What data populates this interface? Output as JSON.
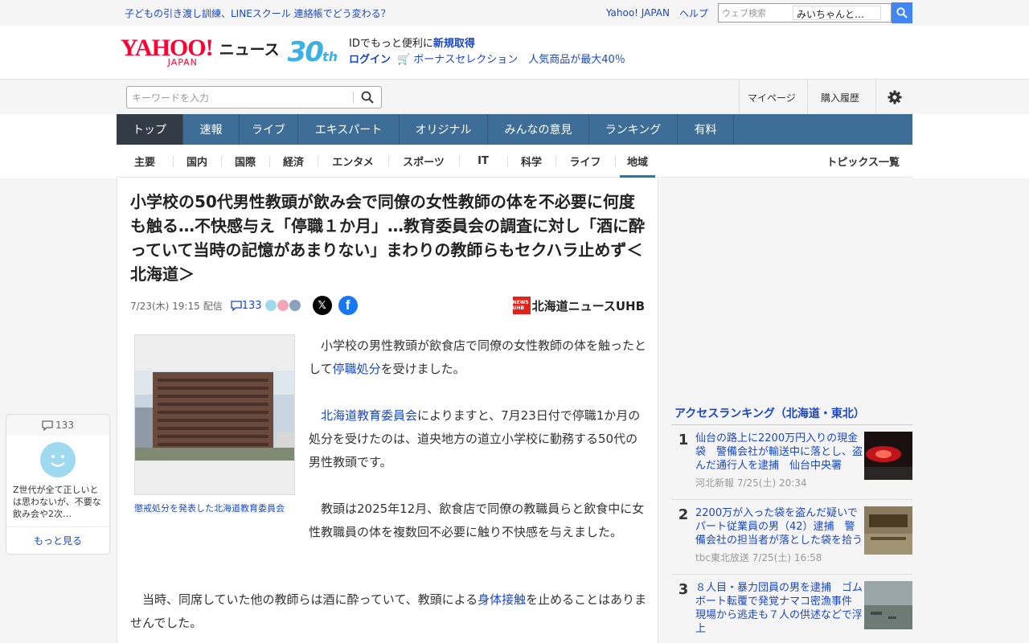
{
  "topbar": {
    "promo": "子どもの引き渡し訓練、LINEスクール 連絡帳でどう変わる？",
    "links": [
      "Yahoo! JAPAN",
      "ヘルプ"
    ],
    "websearch_placeholder": "ウェブ検索",
    "websearch_value": "みいちゃんと…"
  },
  "header": {
    "logo_text": "YAHOO!",
    "logo_sub": "JAPAN",
    "news_label": "ニュース",
    "anniv_num": "30",
    "anniv_suffix": "th",
    "id_text": "IDでもっと便利に",
    "signup": "新規取得",
    "login": "ログイン",
    "bonus": "ボーナスセレクション　人気商品が最大40％"
  },
  "search": {
    "placeholder": "キーワードを入力",
    "mypage": "マイページ",
    "history": "購入履歴"
  },
  "mainnav": [
    "トップ",
    "速報",
    "ライブ",
    "エキスパート",
    "オリジナル",
    "みんなの意見",
    "ランキング",
    "有料"
  ],
  "subnav": [
    "主要",
    "国内",
    "国際",
    "経済",
    "エンタメ",
    "スポーツ",
    "IT",
    "科学",
    "ライフ",
    "地域"
  ],
  "subnav_right": "トピックス一覧",
  "article": {
    "title": "小学校の50代男性教頭が飲み会で同僚の女性教師の体を不必要に何度も触る…不快感与え「停職１か月」…教育委員会の調査に対し「酒に酔っていて当時の記憶があまりない」まわりの教師らもセクハラ止めず＜北海道＞",
    "date": "7/23(木) 19:15",
    "delivered": "配信",
    "comments": "133",
    "source": "北海道ニュースUHB",
    "source_mark": "NEWS UHB",
    "caption": "懲戒処分を発表した北海道教育委員会",
    "p1_pre": "小学校の男性教頭が飲食店で同僚の女性教師の体を触ったとして",
    "p1_link": "停職処分",
    "p1_post": "を受けました。",
    "p2_link": "北海道教育委員会",
    "p2_post": "によりますと、7月23日付で停職1か月の処分を受けたのは、道央地方の道立小学校に勤務する50代の男性教頭です。",
    "p3": "教頭は2025年12月、飲食店で同僚の教職員らと飲食中に女性教職員の体を複数回不必要に触り不快感を与えました。",
    "p4_pre": "当時、同席していた他の教師らは酒に酔っていて、教頭による",
    "p4_link": "身体接触",
    "p4_post": "を止めることはありませんでした。"
  },
  "comment_card": {
    "count": "133",
    "text": "Z世代が全て正しいとは思わないが、不要な飲み会や2次…",
    "more": "もっと見る"
  },
  "ranking": {
    "title": "アクセスランキング（北海道・東北）",
    "items": [
      {
        "rank": "1",
        "title": "仙台の路上に2200万円入りの現金袋　警備会社が輸送中に落とし、盗んだ通行人を逮捕　仙台中央署",
        "source": "河北新報 7/25(土) 20:34"
      },
      {
        "rank": "2",
        "title": "2200万が入った袋を盗んだ疑いでパート従業員の男（42）逮捕　警備会社の担当者が落とした袋を拾う",
        "source": "tbc東北放送 7/25(土) 16:58"
      },
      {
        "rank": "3",
        "title": "８人目・暴力団員の男を逮捕　ゴムボート転覆で発覚ナマコ密漁事件　現場から逃走も７人の供述などで浮上",
        "source": ""
      }
    ]
  },
  "colors": {
    "accent": "#3e6e98",
    "link": "#1947c7",
    "brand": "#ff0033"
  }
}
